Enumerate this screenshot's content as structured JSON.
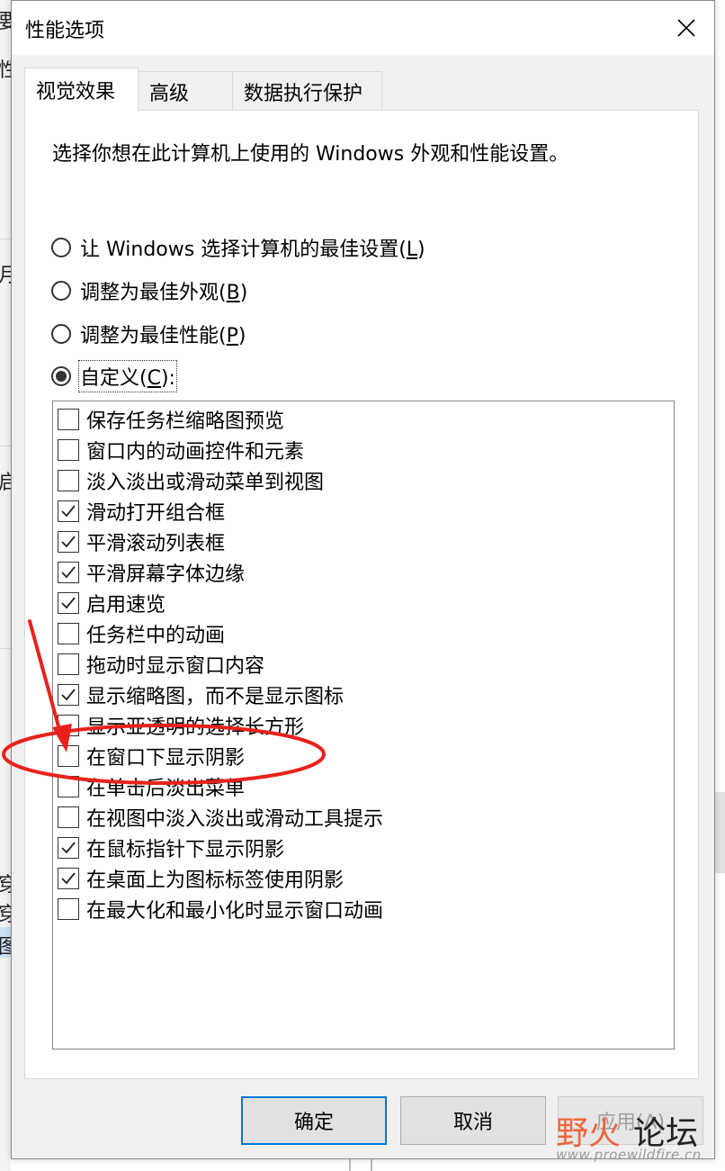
{
  "background_fragments": [
    "要",
    "性",
    "月",
    "启",
    "穿",
    "穿",
    "图"
  ],
  "dialog": {
    "title": "性能选项",
    "close_icon": "close-icon"
  },
  "tabs": [
    {
      "label": "视觉效果",
      "active": true
    },
    {
      "label": "高级",
      "active": false
    },
    {
      "label": "数据执行保护",
      "active": false
    }
  ],
  "intro": "选择你想在此计算机上使用的 Windows 外观和性能设置。",
  "radios": [
    {
      "label": "让 Windows 选择计算机的最佳设置(",
      "accel": "L",
      "close": ")",
      "checked": false
    },
    {
      "label": "调整为最佳外观(",
      "accel": "B",
      "close": ")",
      "checked": false
    },
    {
      "label": "调整为最佳性能(",
      "accel": "P",
      "close": ")",
      "checked": false
    },
    {
      "label": "自定义(",
      "accel": "C",
      "close": "):",
      "checked": true
    }
  ],
  "options": [
    {
      "label": "保存任务栏缩略图预览",
      "checked": false
    },
    {
      "label": "窗口内的动画控件和元素",
      "checked": false
    },
    {
      "label": "淡入淡出或滑动菜单到视图",
      "checked": false
    },
    {
      "label": "滑动打开组合框",
      "checked": true
    },
    {
      "label": "平滑滚动列表框",
      "checked": true
    },
    {
      "label": "平滑屏幕字体边缘",
      "checked": true
    },
    {
      "label": "启用速览",
      "checked": true
    },
    {
      "label": "任务栏中的动画",
      "checked": false
    },
    {
      "label": "拖动时显示窗口内容",
      "checked": false
    },
    {
      "label": "显示缩略图，而不是显示图标",
      "checked": true
    },
    {
      "label": "显示亚透明的选择长方形",
      "checked": false
    },
    {
      "label": "在窗口下显示阴影",
      "checked": false
    },
    {
      "label": "在单击后淡出菜单",
      "checked": false
    },
    {
      "label": "在视图中淡入淡出或滑动工具提示",
      "checked": false
    },
    {
      "label": "在鼠标指针下显示阴影",
      "checked": true
    },
    {
      "label": "在桌面上为图标标签使用阴影",
      "checked": true
    },
    {
      "label": "在最大化和最小化时显示窗口动画",
      "checked": false
    }
  ],
  "buttons": {
    "ok": "确定",
    "cancel": "取消",
    "apply": "应用(A)"
  },
  "annotation": {
    "color": "#e8221b",
    "highlighted_option": "在窗口下显示阴影"
  },
  "watermark": {
    "text_red": "野火",
    "text_dark": "论坛",
    "url": "www.proewildfire.cn"
  }
}
